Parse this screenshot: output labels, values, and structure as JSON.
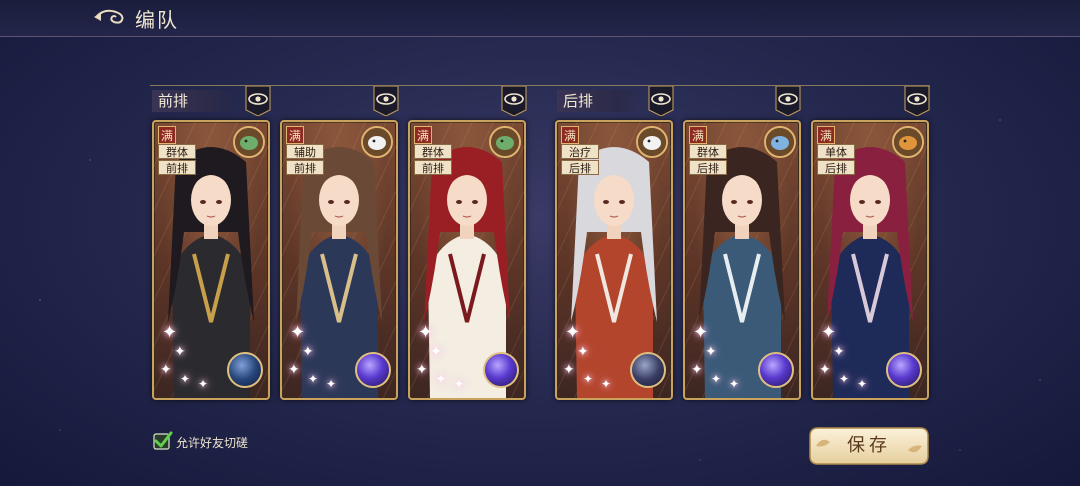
{
  "header": {
    "title": "编队"
  },
  "rows": {
    "front_label": "前排",
    "back_label": "后排"
  },
  "cards": [
    {
      "man": "满",
      "tag1": "群体",
      "tag2": "前排",
      "beast": "green-beast-icon",
      "orb": "blue",
      "hair": "#1e1a1f",
      "robe": "#2b2b2f",
      "accent": "#c8a04a"
    },
    {
      "man": "满",
      "tag1": "辅助",
      "tag2": "前排",
      "beast": "white-bird-icon",
      "orb": "purple",
      "hair": "#6a4a36",
      "robe": "#2c3858",
      "accent": "#d9c08a"
    },
    {
      "man": "满",
      "tag1": "群体",
      "tag2": "前排",
      "beast": "green-beast-icon",
      "orb": "purple",
      "hair": "#9a1f24",
      "robe": "#f3ede2",
      "accent": "#7a1a1f"
    },
    {
      "man": "满",
      "tag1": "治疗",
      "tag2": "后排",
      "beast": "white-bird-icon",
      "orb": "dark",
      "hair": "#d9d8dc",
      "robe": "#b3452c",
      "accent": "#f0e8e0"
    },
    {
      "man": "满",
      "tag1": "群体",
      "tag2": "后排",
      "beast": "blue-fish-icon",
      "orb": "purple",
      "hair": "#3b2520",
      "robe": "#3a5a78",
      "accent": "#e8eef0"
    },
    {
      "man": "满",
      "tag1": "单体",
      "tag2": "后排",
      "beast": "orange-fox-icon",
      "orb": "purple",
      "hair": "#8a2040",
      "robe": "#1e2a58",
      "accent": "#d8c9d8"
    }
  ],
  "footer": {
    "allow_label": "允许好友切磋",
    "save_label": "保存"
  },
  "colors": {
    "gold": "#c9a35d",
    "card_bg": "#6b3e2c",
    "tag_bg": "#efe2c6",
    "star": "#ffffff"
  }
}
